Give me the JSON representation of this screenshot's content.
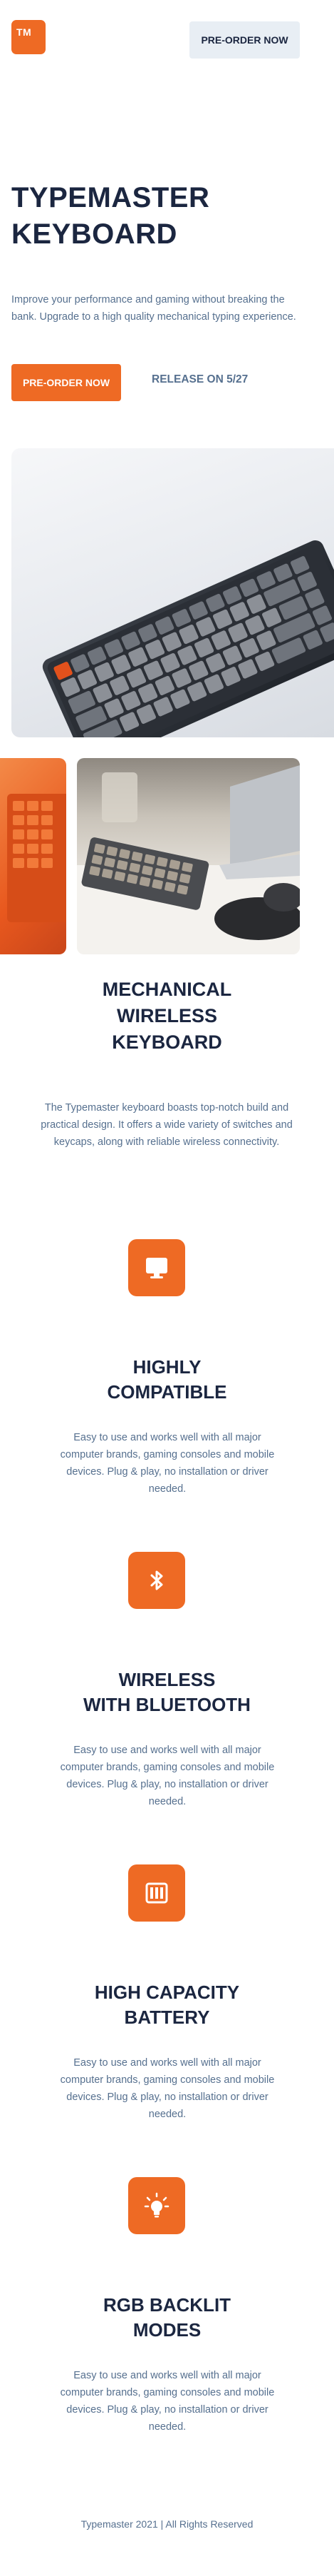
{
  "header": {
    "logo_text": "TM",
    "nav_button_label": "PRE-ORDER NOW"
  },
  "hero": {
    "title_line1": "TYPEMASTER",
    "title_line2": "KEYBOARD",
    "description": "Improve your performance and gaming without breaking the bank. Upgrade to a high quality mechanical typing experience.",
    "cta_label": "PRE-ORDER NOW",
    "release_text": "RELEASE ON 5/27"
  },
  "intro": {
    "title_line1": "MECHANICAL",
    "title_line2": "WIRELESS",
    "title_line3": "KEYBOARD",
    "description": "The Typemaster keyboard boasts top-notch build and practical design. It offers a wide variety of switches and keycaps, along with reliable wireless connectivity."
  },
  "features": [
    {
      "icon": "monitor-icon",
      "title_line1": "HIGHLY",
      "title_line2": "COMPATIBLE",
      "description": "Easy to use and works well with all major computer brands, gaming consoles and mobile devices. Plug & play, no installation or driver needed."
    },
    {
      "icon": "bluetooth-icon",
      "title_line1": "WIRELESS",
      "title_line2": "WITH BLUETOOTH",
      "description": "Easy to use and works well with all major computer brands, gaming consoles and mobile devices. Plug & play, no installation or driver needed."
    },
    {
      "icon": "battery-icon",
      "title_line1": "HIGH CAPACITY",
      "title_line2": "BATTERY",
      "description": "Easy to use and works well with all major computer brands, gaming consoles and mobile devices. Plug & play, no installation or driver needed."
    },
    {
      "icon": "lightbulb-icon",
      "title_line1": "RGB BACKLIT",
      "title_line2": "MODES",
      "description": "Easy to use and works well with all major computer brands, gaming consoles and mobile devices. Plug & play, no installation or driver needed."
    }
  ],
  "footer": {
    "copyright": "Typemaster 2021 | All Rights Reserved"
  },
  "colors": {
    "accent": "#ee6a24",
    "heading": "#1b2640",
    "body_text": "#56708f",
    "nav_button_bg": "#e8eef4"
  }
}
